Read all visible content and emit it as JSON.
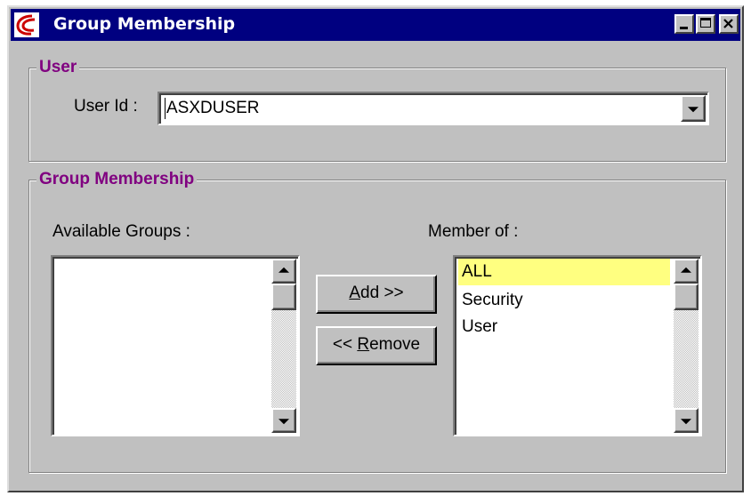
{
  "window": {
    "title": "Group Membership",
    "app_icon": "app-logo-icon"
  },
  "user_group": {
    "title": "User",
    "user_id_label": "User Id :",
    "user_id_value": "ASXDUSER"
  },
  "membership_group": {
    "title": "Group Membership",
    "available_label": "Available Groups :",
    "member_label": "Member of :",
    "available_groups": [],
    "member_of": [
      "ALL",
      "Security",
      "User"
    ],
    "selected_member": "ALL"
  },
  "buttons": {
    "add": {
      "mnemonic": "A",
      "rest": "dd >>"
    },
    "remove": {
      "prefix": "<< ",
      "mnemonic": "R",
      "rest": "emove"
    }
  },
  "colors": {
    "titlebar": "#000080",
    "group_title": "#800080",
    "selection": "#ffff80",
    "face": "#c0c0c0"
  }
}
